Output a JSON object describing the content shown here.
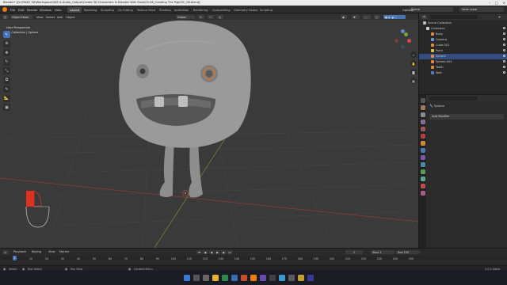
{
  "window": {
    "title": "Blender* [D:\\PIXXO 3D\\Workspace\\G85 & Audio_Output\\Create 3D Characters In Blender With Ease\\03-06_Creating The Pig\\03C_06.blend]",
    "controls": [
      "–",
      "□",
      "✕"
    ]
  },
  "menu": {
    "items": [
      "File",
      "Edit",
      "Render",
      "Window",
      "Help"
    ],
    "workspaces": [
      "Layout",
      "Modeling",
      "Sculpting",
      "UV Editing",
      "Texture Paint",
      "Shading",
      "Animation",
      "Rendering",
      "Compositing",
      "Geometry Nodes",
      "Scripting"
    ],
    "active_workspace": "Layout",
    "scene": "Scene",
    "view_layer": "View Layer"
  },
  "viewport_header": {
    "mode": "Object Mode",
    "menus": [
      "View",
      "Select",
      "Add",
      "Object"
    ],
    "transform": "Global",
    "options": "Options"
  },
  "viewport": {
    "overlay_line1": "User Perspective",
    "overlay_line2": "(1) Collection | Sphere",
    "gizmo": {
      "x": "X",
      "y": "Y",
      "z": "Z"
    },
    "colors": {
      "background": "#3a3a3a",
      "body": "#9a9a9a",
      "eye_ring": "#c8783a",
      "x_axis": "#a0443e",
      "y_axis": "#7a9a3a",
      "accent": "#4772b3"
    }
  },
  "outliner": {
    "scene_collection": "Scene Collection",
    "items": [
      {
        "label": "Collection",
        "color": "#cfcfcf",
        "selected": false
      },
      {
        "label": "Body",
        "color": "#e08a3a",
        "selected": false
      },
      {
        "label": "Camera",
        "color": "#6a9ad4",
        "selected": false
      },
      {
        "label": "Cube.001",
        "color": "#e08a3a",
        "selected": false
      },
      {
        "label": "Point",
        "color": "#e0c040",
        "selected": false
      },
      {
        "label": "Sphere",
        "color": "#e08a3a",
        "selected": true
      },
      {
        "label": "Sphere.001",
        "color": "#e08a3a",
        "selected": false
      },
      {
        "label": "Teeth",
        "color": "#e08a3a",
        "selected": false
      },
      {
        "label": "Wall",
        "color": "#5a7ac0",
        "selected": false
      }
    ]
  },
  "properties": {
    "object_name": "Sphere",
    "add_modifier": "Add Modifier"
  },
  "timeline": {
    "menus": [
      "Playback",
      "Keying",
      "View",
      "Marker"
    ],
    "current_frame": "1",
    "start_label": "Start",
    "start": "1",
    "end_label": "End",
    "end": "250",
    "ticks": [
      "0",
      "10",
      "20",
      "30",
      "40",
      "50",
      "60",
      "70",
      "80",
      "90",
      "100",
      "110",
      "120",
      "130",
      "140",
      "150",
      "160",
      "170",
      "180",
      "190",
      "200",
      "210",
      "220",
      "230",
      "240",
      "250"
    ]
  },
  "statusbar": {
    "select": "Select",
    "box_select": "Box Select",
    "pan_view": "Pan View",
    "context_menu": "Context Menu",
    "version": "3.0.0 Alpha"
  }
}
